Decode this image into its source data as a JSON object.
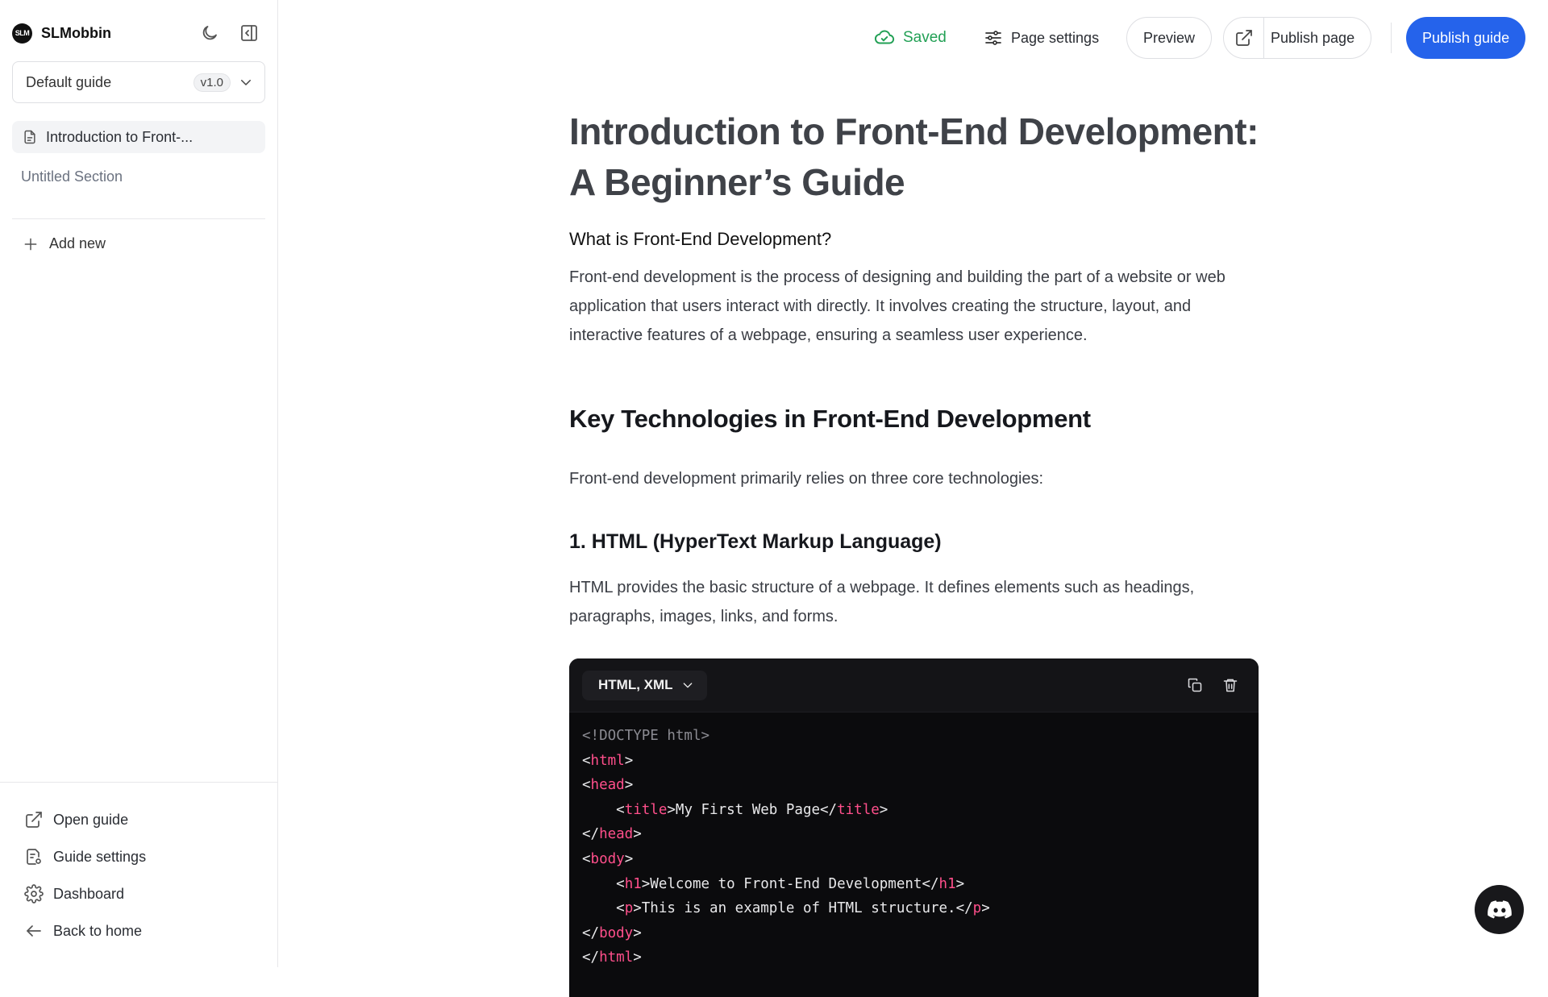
{
  "sidebar": {
    "brand": {
      "logo_text": "SLM",
      "name": "SLMobbin"
    },
    "guide_select": {
      "label": "Default guide",
      "version": "v1.0"
    },
    "pages": [
      {
        "label": "Introduction to Front-..."
      }
    ],
    "sections": [
      {
        "label": "Untitled Section"
      }
    ],
    "add_new_label": "Add new",
    "bottom": {
      "open_guide": "Open guide",
      "guide_settings": "Guide settings",
      "dashboard": "Dashboard",
      "back_home": "Back to home"
    }
  },
  "topbar": {
    "saved": "Saved",
    "page_settings": "Page settings",
    "preview": "Preview",
    "publish_page": "Publish page",
    "publish_guide": "Publish guide"
  },
  "content": {
    "title": "Introduction to Front-End Development: A Beginner’s Guide",
    "subtitle": "What is Front-End Development?",
    "p1": "Front-end development is the process of designing and building the part of a website or web application that users interact with directly. It involves creating the structure, layout, and interactive features of a webpage, ensuring a seamless user experience.",
    "h2": "Key Technologies in Front-End Development",
    "p2": "Front-end development primarily relies on three core technologies:",
    "h3": "1. HTML (HyperText Markup Language)",
    "p3": "HTML provides the basic structure of a webpage. It defines elements such as headings, paragraphs, images, links, and forms.",
    "code": {
      "language": "HTML, XML",
      "lines": [
        "<!DOCTYPE html>",
        "<html>",
        "<head>",
        "    <title>My First Web Page</title>",
        "</head>",
        "<body>",
        "    <h1>Welcome to Front-End Development</h1>",
        "    <p>This is an example of HTML structure.</p>",
        "</body>",
        "</html>"
      ]
    }
  },
  "colors": {
    "accent": "#2563eb",
    "saved_green": "#22a055",
    "code_tag": "#ff4f8b",
    "code_bg": "#0b0b0d"
  },
  "icons": {
    "theme": "moon-icon",
    "collapse": "sidebar-collapse-icon",
    "page": "document-icon",
    "add": "plus-icon",
    "open_guide": "external-link-icon",
    "guide_settings": "settings-doc-icon",
    "dashboard": "gear-icon",
    "back_home": "arrow-left-icon",
    "saved": "cloud-check-icon",
    "page_settings": "sliders-icon",
    "publish_page": "external-link-icon",
    "copy": "copy-icon",
    "delete": "trash-icon",
    "support": "discord-icon"
  }
}
